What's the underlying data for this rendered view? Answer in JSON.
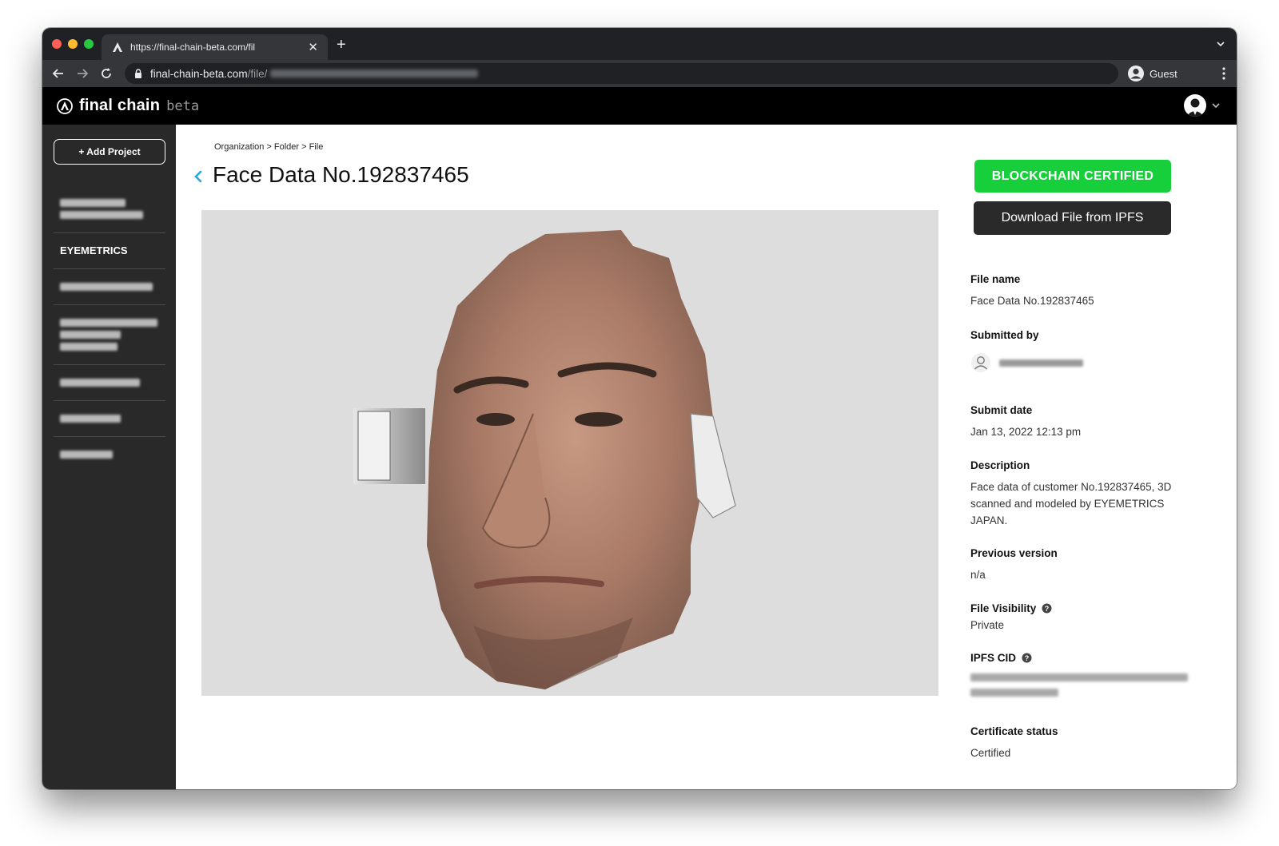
{
  "browser": {
    "tab_title": "https://final-chain-beta.com/fil",
    "new_tab_symbol": "+",
    "url_host": "final-chain-beta.com",
    "url_path": "/file/",
    "profile_label": "Guest"
  },
  "app": {
    "brand_name": "final chain",
    "brand_tag": "beta"
  },
  "sidebar": {
    "add_project_label": "+ Add Project",
    "visible_project": "EYEMETRICS"
  },
  "main": {
    "breadcrumb": "Organization > Folder > File",
    "title": "Face Data No.192837465"
  },
  "panel": {
    "certified_button": "BLOCKCHAIN CERTIFIED",
    "download_button": "Download File from IPFS",
    "file_name_label": "File name",
    "file_name_value": "Face Data No.192837465",
    "submitted_by_label": "Submitted by",
    "submit_date_label": "Submit date",
    "submit_date_value": "Jan 13, 2022 12:13 pm",
    "description_label": "Description",
    "description_value": "Face data of customer No.192837465, 3D scanned and modeled by EYEMETRICS JAPAN.",
    "previous_version_label": "Previous version",
    "previous_version_value": "n/a",
    "visibility_label": "File Visibility",
    "visibility_value": "Private",
    "ipfs_cid_label": "IPFS CID",
    "certificate_status_label": "Certificate status",
    "certificate_status_value": "Certified"
  },
  "colors": {
    "certified_green": "#16cf3b",
    "sidebar_bg": "#292929",
    "header_bg": "#000000",
    "back_arrow_blue": "#2ba6de"
  }
}
